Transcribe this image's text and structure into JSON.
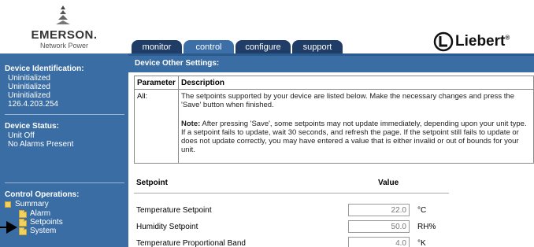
{
  "brand": {
    "name": "EMERSON.",
    "tagline": "Network Power",
    "partner": "Liebert",
    "partner_mark": "®"
  },
  "tabs": [
    {
      "label": "monitor",
      "active": false
    },
    {
      "label": "control",
      "active": true
    },
    {
      "label": "configure",
      "active": false
    },
    {
      "label": "support",
      "active": false
    }
  ],
  "sidebar": {
    "device_id_title": "Device Identification:",
    "device_id_lines": [
      "Uninitialized",
      "Uninitialized",
      "Uninitialized",
      "126.4.203.254"
    ],
    "status_title": "Device Status:",
    "status_lines": [
      "Unit Off",
      "No Alarms Present"
    ],
    "control_title": "Control Operations:",
    "tree": [
      {
        "label": "Summary",
        "level": 0
      },
      {
        "label": "Alarm",
        "level": 1
      },
      {
        "label": "Setpoints",
        "level": 1
      },
      {
        "label": "System",
        "level": 1
      }
    ]
  },
  "main": {
    "title": "Device Other Settings:",
    "table_headers": [
      "Parameter",
      "Description"
    ],
    "param": "All:",
    "description_1": "The setpoints supported by your device are listed below.  Make the necessary changes and press the 'Save' button when finished.",
    "note_label": "Note:",
    "description_2": " After pressing 'Save', some setpoints may not update immediately, depending upon your unit type. If a setpoint fails to update, wait 30 seconds, and refresh the page.  If the setpoint still fails to update or does not update correctly, you may have entered a value that is either invalid or out of bounds for your unit.",
    "setpoint_header": "Setpoint",
    "value_header": "Value",
    "setpoints": [
      {
        "label": "Temperature Setpoint",
        "value": "22.0",
        "unit": "°C"
      },
      {
        "label": "Humidity Setpoint",
        "value": "50.0",
        "unit": "RH%"
      },
      {
        "label": "Temperature Proportional Band",
        "value": "4.0",
        "unit": "°K"
      }
    ]
  },
  "colors": {
    "sidebar_blue": "#3a6da3",
    "tab_navy": "#1f3d66",
    "folder_yellow": "#f2d25e"
  }
}
